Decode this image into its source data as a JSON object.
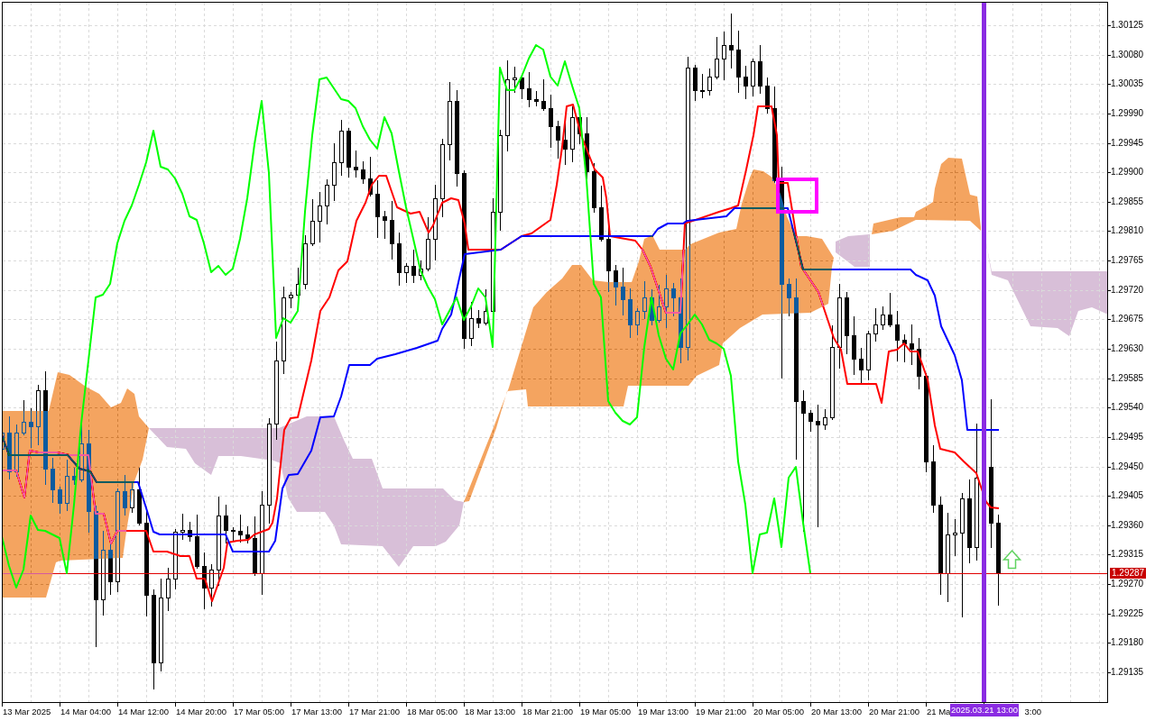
{
  "price_axis": {
    "ticks": [
      "1.30125",
      "1.30080",
      "1.30035",
      "1.29990",
      "1.29945",
      "1.29900",
      "1.29855",
      "1.29810",
      "1.29765",
      "1.29720",
      "1.29675",
      "1.29630",
      "1.29585",
      "1.29540",
      "1.29495",
      "1.29450",
      "1.29405",
      "1.29360",
      "1.29315",
      "1.29270",
      "1.29225",
      "1.29180",
      "1.29135"
    ],
    "current_price": "1.29287"
  },
  "time_axis": {
    "labels": [
      "13 Mar 2025",
      "14 Mar 04:00",
      "14 Mar 12:00",
      "14 Mar 20:00",
      "17 Mar 05:00",
      "17 Mar 13:00",
      "17 Mar 21:00",
      "18 Mar 05:00",
      "18 Mar 13:00",
      "18 Mar 21:00",
      "19 Mar 05:00",
      "19 Mar 13:00",
      "19 Mar 21:00",
      "20 Mar 05:00",
      "20 Mar 13:00",
      "20 Mar 21:00",
      "21 Ma",
      "3:00"
    ],
    "cursor_time": "2025.03.21 13:00"
  }
}
